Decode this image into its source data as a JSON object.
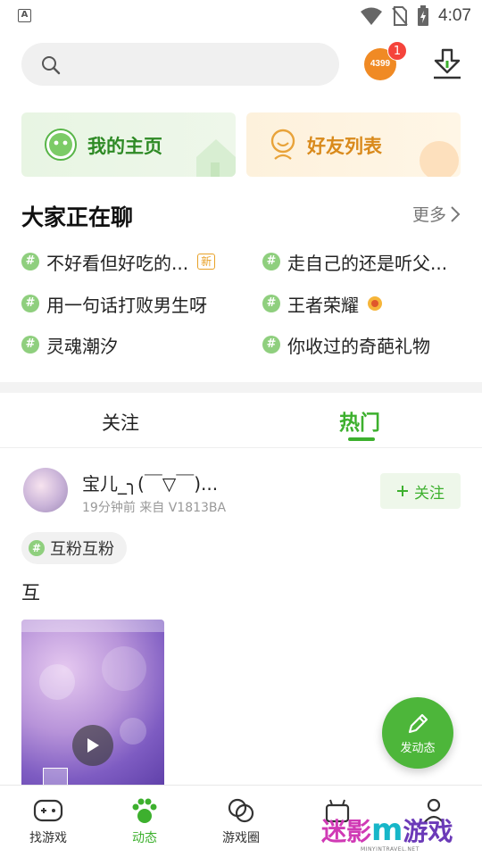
{
  "status_bar": {
    "time": "4:07",
    "app_indicator": "A"
  },
  "header": {
    "search_placeholder": "",
    "brand_badge": "4399",
    "notification_count": "1"
  },
  "quick_cards": {
    "home": {
      "label": "我的主页",
      "icon": "smile-face-icon"
    },
    "friends": {
      "label": "好友列表",
      "icon": "friends-icon"
    }
  },
  "chat_section": {
    "title": "大家正在聊",
    "more": "更多",
    "hash": "#",
    "new_tag": "新",
    "topics": [
      {
        "text": "不好看但好吃的..."
      },
      {
        "text": "走自己的还是听父..."
      },
      {
        "text": "用一句话打败男生呀"
      },
      {
        "text": "王者荣耀"
      },
      {
        "text": "灵魂潮汐"
      },
      {
        "text": "你收过的奇葩礼物"
      }
    ]
  },
  "feed_tabs": {
    "follow": "关注",
    "hot": "热门",
    "active": "hot"
  },
  "post": {
    "username": "宝儿_╮(￣▽￣)...",
    "meta": "19分钟前  来自 V1813BA",
    "follow_label": "关注",
    "topic": "互粉互粉",
    "text": "互"
  },
  "fab": {
    "label": "发动态"
  },
  "bottom_nav": [
    {
      "label": "找游戏",
      "icon": "gamepad-icon",
      "active": false
    },
    {
      "label": "动态",
      "icon": "paw-icon",
      "active": true
    },
    {
      "label": "游戏圈",
      "icon": "circles-icon",
      "active": false
    },
    {
      "label": "",
      "icon": "gift-icon",
      "active": false
    },
    {
      "label": "",
      "icon": "user-icon",
      "active": false
    }
  ],
  "watermark": {
    "part_a": "迷影",
    "part_m": "m",
    "part_b": "游戏",
    "url": "MINYINTRAVEL.NET"
  },
  "colors": {
    "accent": "#3db02e",
    "friends_accent": "#d98a1c",
    "badge_red": "#f5443b"
  }
}
